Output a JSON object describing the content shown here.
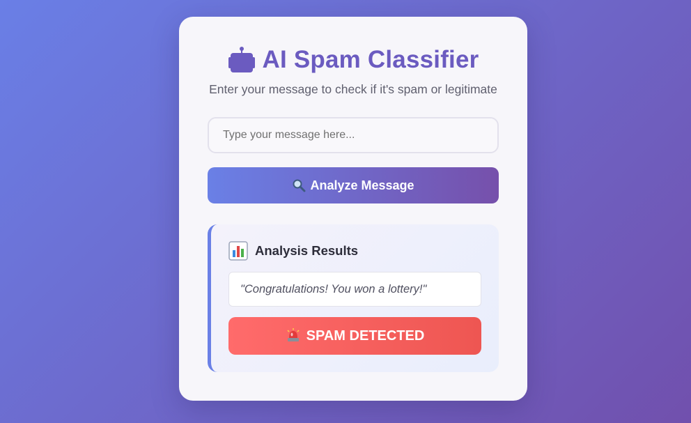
{
  "header": {
    "icon": "robot-icon",
    "title": "AI Spam Classifier",
    "subtitle": "Enter your message to check if it's spam or legitimate"
  },
  "input": {
    "placeholder": "Type your message here...",
    "value": ""
  },
  "analyze_button": {
    "icon": "magnifier-icon",
    "label": "Analyze Message"
  },
  "results": {
    "icon": "bar-chart-icon",
    "title": "Analysis Results",
    "message": "\"Congratulations! You won a lottery!\"",
    "verdict_icon": "siren-icon",
    "verdict": "SPAM DETECTED"
  },
  "colors": {
    "accent": "#6b5bc0",
    "gradient_start": "#6a80e6",
    "gradient_end": "#7650ab",
    "spam": "#ff6b6b"
  }
}
